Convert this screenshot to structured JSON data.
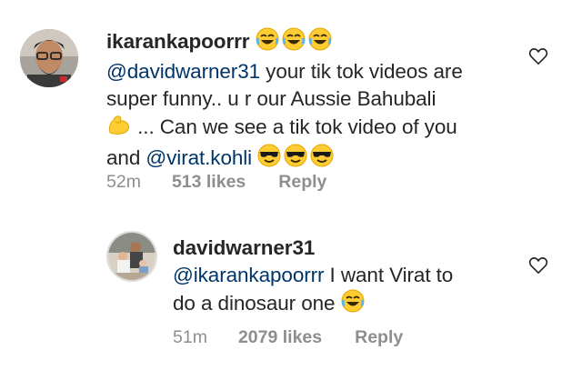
{
  "comments": [
    {
      "username": "ikarankapoorrr",
      "mention1": "@davidwarner31",
      "text1": " your tik tok videos are",
      "text2": "super funny.. u r our Aussie Bahubali",
      "text3": "... Can we see a tik tok video of you",
      "text4": "and ",
      "mention2": "@virat.kohli",
      "time": "52m",
      "likes": "513 likes",
      "reply": "Reply",
      "icons": [
        "laughing-emoji",
        "muscle-emoji",
        "sunglasses-emoji",
        "heart-icon"
      ]
    },
    {
      "username": "davidwarner31",
      "mention1": "@ikarankapoorrr",
      "text1": " I want Virat to",
      "text2": "do a dinosaur one",
      "time": "51m",
      "likes": "2079 likes",
      "reply": "Reply",
      "icons": [
        "laughing-emoji",
        "heart-icon"
      ]
    }
  ],
  "colors": {
    "text": "#262626",
    "mention": "#003569",
    "meta": "#8e8e8e",
    "emoji": "#ffcc33"
  }
}
